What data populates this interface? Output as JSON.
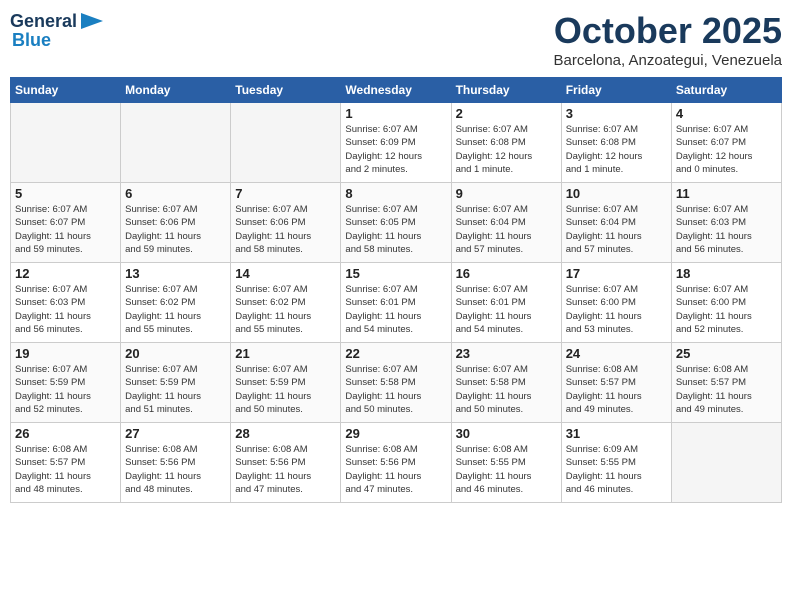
{
  "header": {
    "logo_line1": "General",
    "logo_line2": "Blue",
    "month": "October 2025",
    "location": "Barcelona, Anzoategui, Venezuela"
  },
  "weekdays": [
    "Sunday",
    "Monday",
    "Tuesday",
    "Wednesday",
    "Thursday",
    "Friday",
    "Saturday"
  ],
  "weeks": [
    [
      {
        "day": "",
        "info": ""
      },
      {
        "day": "",
        "info": ""
      },
      {
        "day": "",
        "info": ""
      },
      {
        "day": "1",
        "info": "Sunrise: 6:07 AM\nSunset: 6:09 PM\nDaylight: 12 hours\nand 2 minutes."
      },
      {
        "day": "2",
        "info": "Sunrise: 6:07 AM\nSunset: 6:08 PM\nDaylight: 12 hours\nand 1 minute."
      },
      {
        "day": "3",
        "info": "Sunrise: 6:07 AM\nSunset: 6:08 PM\nDaylight: 12 hours\nand 1 minute."
      },
      {
        "day": "4",
        "info": "Sunrise: 6:07 AM\nSunset: 6:07 PM\nDaylight: 12 hours\nand 0 minutes."
      }
    ],
    [
      {
        "day": "5",
        "info": "Sunrise: 6:07 AM\nSunset: 6:07 PM\nDaylight: 11 hours\nand 59 minutes."
      },
      {
        "day": "6",
        "info": "Sunrise: 6:07 AM\nSunset: 6:06 PM\nDaylight: 11 hours\nand 59 minutes."
      },
      {
        "day": "7",
        "info": "Sunrise: 6:07 AM\nSunset: 6:06 PM\nDaylight: 11 hours\nand 58 minutes."
      },
      {
        "day": "8",
        "info": "Sunrise: 6:07 AM\nSunset: 6:05 PM\nDaylight: 11 hours\nand 58 minutes."
      },
      {
        "day": "9",
        "info": "Sunrise: 6:07 AM\nSunset: 6:04 PM\nDaylight: 11 hours\nand 57 minutes."
      },
      {
        "day": "10",
        "info": "Sunrise: 6:07 AM\nSunset: 6:04 PM\nDaylight: 11 hours\nand 57 minutes."
      },
      {
        "day": "11",
        "info": "Sunrise: 6:07 AM\nSunset: 6:03 PM\nDaylight: 11 hours\nand 56 minutes."
      }
    ],
    [
      {
        "day": "12",
        "info": "Sunrise: 6:07 AM\nSunset: 6:03 PM\nDaylight: 11 hours\nand 56 minutes."
      },
      {
        "day": "13",
        "info": "Sunrise: 6:07 AM\nSunset: 6:02 PM\nDaylight: 11 hours\nand 55 minutes."
      },
      {
        "day": "14",
        "info": "Sunrise: 6:07 AM\nSunset: 6:02 PM\nDaylight: 11 hours\nand 55 minutes."
      },
      {
        "day": "15",
        "info": "Sunrise: 6:07 AM\nSunset: 6:01 PM\nDaylight: 11 hours\nand 54 minutes."
      },
      {
        "day": "16",
        "info": "Sunrise: 6:07 AM\nSunset: 6:01 PM\nDaylight: 11 hours\nand 54 minutes."
      },
      {
        "day": "17",
        "info": "Sunrise: 6:07 AM\nSunset: 6:00 PM\nDaylight: 11 hours\nand 53 minutes."
      },
      {
        "day": "18",
        "info": "Sunrise: 6:07 AM\nSunset: 6:00 PM\nDaylight: 11 hours\nand 52 minutes."
      }
    ],
    [
      {
        "day": "19",
        "info": "Sunrise: 6:07 AM\nSunset: 5:59 PM\nDaylight: 11 hours\nand 52 minutes."
      },
      {
        "day": "20",
        "info": "Sunrise: 6:07 AM\nSunset: 5:59 PM\nDaylight: 11 hours\nand 51 minutes."
      },
      {
        "day": "21",
        "info": "Sunrise: 6:07 AM\nSunset: 5:59 PM\nDaylight: 11 hours\nand 50 minutes."
      },
      {
        "day": "22",
        "info": "Sunrise: 6:07 AM\nSunset: 5:58 PM\nDaylight: 11 hours\nand 50 minutes."
      },
      {
        "day": "23",
        "info": "Sunrise: 6:07 AM\nSunset: 5:58 PM\nDaylight: 11 hours\nand 50 minutes."
      },
      {
        "day": "24",
        "info": "Sunrise: 6:08 AM\nSunset: 5:57 PM\nDaylight: 11 hours\nand 49 minutes."
      },
      {
        "day": "25",
        "info": "Sunrise: 6:08 AM\nSunset: 5:57 PM\nDaylight: 11 hours\nand 49 minutes."
      }
    ],
    [
      {
        "day": "26",
        "info": "Sunrise: 6:08 AM\nSunset: 5:57 PM\nDaylight: 11 hours\nand 48 minutes."
      },
      {
        "day": "27",
        "info": "Sunrise: 6:08 AM\nSunset: 5:56 PM\nDaylight: 11 hours\nand 48 minutes."
      },
      {
        "day": "28",
        "info": "Sunrise: 6:08 AM\nSunset: 5:56 PM\nDaylight: 11 hours\nand 47 minutes."
      },
      {
        "day": "29",
        "info": "Sunrise: 6:08 AM\nSunset: 5:56 PM\nDaylight: 11 hours\nand 47 minutes."
      },
      {
        "day": "30",
        "info": "Sunrise: 6:08 AM\nSunset: 5:55 PM\nDaylight: 11 hours\nand 46 minutes."
      },
      {
        "day": "31",
        "info": "Sunrise: 6:09 AM\nSunset: 5:55 PM\nDaylight: 11 hours\nand 46 minutes."
      },
      {
        "day": "",
        "info": ""
      }
    ]
  ]
}
